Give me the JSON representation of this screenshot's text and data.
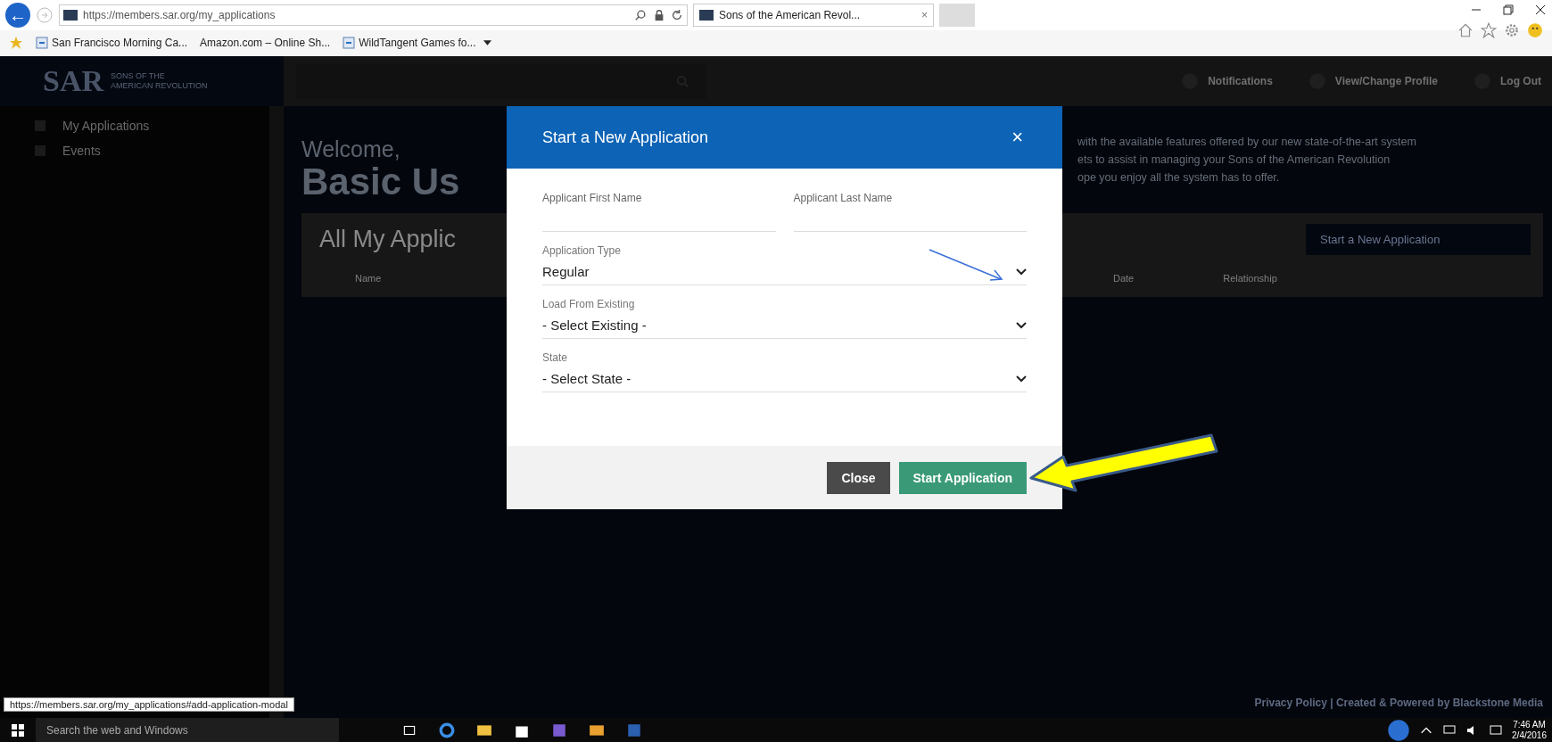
{
  "browser": {
    "back_icon": "←",
    "url": "https://members.sar.org/my_applications",
    "tab": {
      "title": "Sons of the American Revol...",
      "close": "×"
    },
    "favorites": [
      {
        "label": "San Francisco Morning Ca..."
      },
      {
        "label": "Amazon.com – Online Sh..."
      },
      {
        "label": "WildTangent Games fo..."
      }
    ]
  },
  "site_header": {
    "logo": "SAR",
    "logo_subtitle": [
      "SONS OF THE",
      "AMERICAN REVOLUTION"
    ],
    "nav": [
      {
        "label": "Notifications"
      },
      {
        "label": "View/Change Profile"
      },
      {
        "label": "Log Out"
      }
    ]
  },
  "sidebar": {
    "items": [
      {
        "label": "My Applications"
      },
      {
        "label": "Events"
      }
    ]
  },
  "welcome": {
    "greeting": "Welcome,",
    "name": "Basic Us",
    "intro_lines": [
      "with the available features offered by our new state-of-the-art system",
      "ets to assist in managing your Sons of the American Revolution",
      "ope you enjoy all the system has to offer."
    ]
  },
  "applications_card": {
    "title": "All My Applic",
    "new_button": "Start a New Application",
    "columns": [
      "Name",
      "Date",
      "Relationship"
    ]
  },
  "footer": "Privacy Policy | Created & Powered by Blackstone Media",
  "modal": {
    "title": "Start a New Application",
    "close": "×",
    "name_fields": [
      {
        "label": "Applicant First Name"
      },
      {
        "label": "Applicant Last Name"
      }
    ],
    "selects": [
      {
        "label": "Application Type",
        "value": "Regular"
      },
      {
        "label": "Load From Existing",
        "value": "- Select Existing -"
      },
      {
        "label": "State",
        "value": "- Select State -"
      }
    ],
    "buttons": [
      {
        "label": "Close",
        "kind": "secondary"
      },
      {
        "label": "Start Application",
        "kind": "primary"
      }
    ]
  },
  "annotations": [
    {
      "kind": "line-arrow"
    },
    {
      "kind": "block-arrow"
    }
  ],
  "status_url": "https://members.sar.org/my_applications#add-application-modal",
  "taskbar": {
    "search": {
      "placeholder": "Search the web and Windows"
    },
    "time": "7:46 AM",
    "date": "2/4/2016"
  }
}
